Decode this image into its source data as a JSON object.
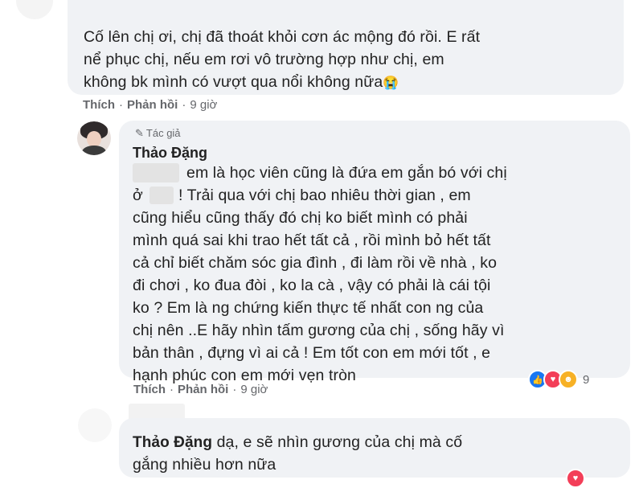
{
  "comment1": {
    "lines": [
      "Cố lên chị ơi, chị đã thoát khỏi cơn ác mộng đó rồi. E rất",
      "nể phục chị, nếu em rơi vô trường hợp như chị, em",
      "không bk mình có vượt qua nổi không nữa"
    ],
    "emoji": "😭",
    "like_label": "Thích",
    "reply_label": "Phản hồi",
    "time": "9 giờ"
  },
  "reply1": {
    "author_tag": "Tác giả",
    "author_name": "Thảo Đặng",
    "first_line": "em là học viên cũng là đứa em gắn bó với chị",
    "second_line_prefix": "ở",
    "second_line_rest": "! Trải qua với chị bao nhiêu thời gian , em",
    "lines": [
      "cũng hiểu cũng thấy đó chị ko biết mình có phải",
      "mình quá sai khi trao hết tất cả , rồi mình bỏ hết tất",
      "cả chỉ biết chăm sóc gia đình , đi làm rồi về nhà , ko",
      "đi chơi , ko đua đòi , ko la cà , vậy có phải là cái tội",
      "ko ? Em là ng chứng kiến thực tế nhất con ng của",
      "chị nên ..E hãy nhìn tấm gương của chị , sống hãy vì",
      "bản thân , đựng vì ai cả ! Em tốt con em mới tốt , e",
      "hạnh phúc con em mới vẹn tròn"
    ],
    "reaction_count": "9",
    "reaction_icons": [
      "like-icon",
      "love-icon",
      "care-icon"
    ],
    "like_label": "Thích",
    "reply_label": "Phản hồi",
    "time": "9 giờ"
  },
  "reply2": {
    "author_name": "Thảo Đặng",
    "first_line_rest": "dạ, e sẽ nhìn gương của chị mà cố",
    "second_line": "gắng nhiều hơn nữa"
  },
  "colors": {
    "bubble": "#f0f2f5",
    "meta": "#65676b",
    "like_blue": "#1877f2",
    "love_red": "#f33e58",
    "care_yellow": "#f7b125"
  }
}
